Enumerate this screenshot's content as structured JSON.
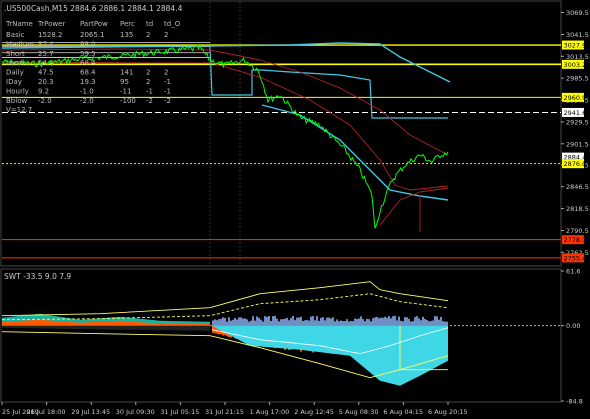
{
  "header": {
    "title": ".US500Cash,M15  2884.6 2886.1 2884.1 2884.4"
  },
  "info_table": {
    "columns": [
      "TrName",
      "TrPower",
      "PartPow",
      "Perc",
      "td",
      "td_O"
    ],
    "rows": [
      [
        "Basic",
        "1528.2",
        "2065.1",
        "135",
        "2",
        "2"
      ],
      [
        "Medium",
        "57.4",
        "98.0",
        "",
        "",
        ""
      ],
      [
        "Short",
        "25.7",
        "59.5",
        "",
        "",
        ""
      ],
      [
        "Local",
        "54.4",
        "68.4",
        "",
        "",
        ""
      ],
      [
        "Daily",
        "47.5",
        "68.4",
        "141",
        "2",
        "2"
      ],
      [
        "IDay",
        "20.3",
        "19.3",
        "95",
        "2",
        "-1"
      ],
      [
        "Hourly",
        "9.2",
        "-1.0",
        "-11",
        "-1",
        "-1"
      ],
      [
        "Bblow",
        "-2.0",
        "-2.0",
        "-100",
        "-2",
        "-2"
      ]
    ],
    "footer": "V=12.7"
  },
  "price_axis": {
    "ticks": [
      "3069.5",
      "3041.5",
      "3013.5",
      "2985.5",
      "2957.5",
      "2929.5",
      "2901.5",
      "2874.5",
      "2846.5",
      "2818.5",
      "2790.5",
      "2762.5"
    ],
    "ymin": 2745,
    "ymax": 3083
  },
  "level_labels": [
    {
      "text": "3027.9",
      "value": 3027.9,
      "color": "#ffff00"
    },
    {
      "text": "3003.2",
      "value": 3003.2,
      "color": "#ffff00"
    },
    {
      "text": "2960.9",
      "value": 2960.9,
      "color": "#ffff00"
    },
    {
      "text": "2941.6",
      "value": 2941.6,
      "color": "#ffffff"
    },
    {
      "text": "2884.4",
      "value": 2884.4,
      "color": "#ffffff"
    },
    {
      "text": "2876.0",
      "value": 2876.0,
      "color": "#ffff00"
    },
    {
      "text": "2778.7",
      "value": 2778.7,
      "color": "#ff3300"
    },
    {
      "text": "2755.4",
      "value": 2755.4,
      "color": "#ff3300"
    }
  ],
  "indicator": {
    "title": "SWT  -33.5  9.0  7.9",
    "ticks": [
      "61.6",
      "0.00",
      "-84.8"
    ],
    "ymin": -84.8,
    "ymax": 61.6
  },
  "time_axis": [
    "25 Jul 2019",
    "26 Jul 18:00",
    "29 Jul 13:45",
    "30 Jul 09:30",
    "31 Jul 05:15",
    "31 Jul 21:15",
    "1 Aug 17:00",
    "2 Aug 12:45",
    "5 Aug 08:30",
    "6 Aug 04:15",
    "6 Aug 20:15"
  ],
  "colors": {
    "background": "#000000",
    "price": "#00ff00",
    "cyan_channel": "#3fc8e6",
    "red_ma": "#b22222",
    "yellow_level": "#ffff00",
    "bars_orange": "#ff5a00",
    "bars_cyan": "#3fd6e6",
    "bars_blue": "#6f8fc4"
  },
  "chart_data": {
    "type": "line",
    "x": [
      "25 Jul 2019",
      "26 Jul 18:00",
      "29 Jul 13:45",
      "30 Jul 09:30",
      "31 Jul 05:15",
      "31 Jul 21:15",
      "1 Aug 17:00",
      "2 Aug 12:45",
      "5 Aug 08:30",
      "6 Aug 04:15",
      "6 Aug 20:15"
    ],
    "series": [
      {
        "values": [
          3018,
          3020,
          3021,
          3020,
          3024,
          3005,
          2980,
          2935,
          2870,
          2830,
          2884
        ]
      }
    ],
    "ylim": [
      2745,
      3083
    ],
    "indicator_series": [
      {
        "values": [
          1,
          2,
          3,
          4,
          5,
          -10,
          -20,
          -25,
          -40,
          -60,
          -5
        ]
      }
    ],
    "indicator_ylim": [
      -84.8,
      61.6
    ]
  }
}
